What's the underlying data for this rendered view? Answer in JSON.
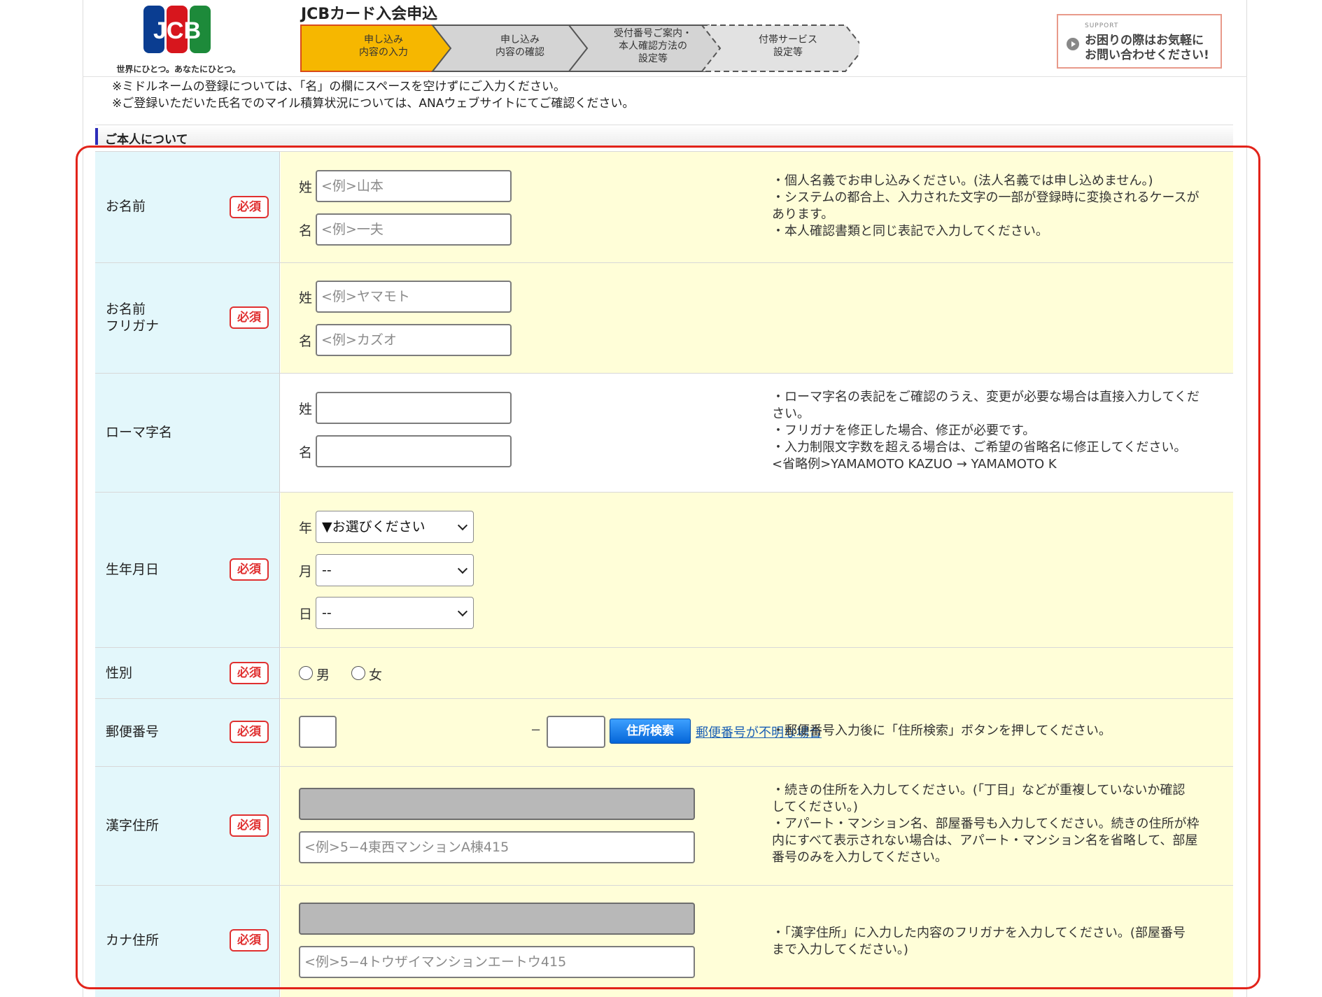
{
  "header": {
    "logo_text": "JCB",
    "logo_tagline": "世界にひとつ。あなたにひとつ。",
    "title": "JCBカード入会申込",
    "steps": [
      {
        "line1": "申し込み",
        "line2": "内容の入力",
        "line3": ""
      },
      {
        "line1": "申し込み",
        "line2": "内容の確認",
        "line3": ""
      },
      {
        "line1": "受付番号ご案内・",
        "line2": "本人確認方法の",
        "line3": "設定等"
      },
      {
        "line1": "付帯サービス",
        "line2": "設定等",
        "line3": ""
      }
    ],
    "support": {
      "small": "SUPPORT",
      "line1": "お困りの際はお気軽に",
      "line2": "お問い合わせください!"
    }
  },
  "notes": [
    "※ミドルネームの登録については、「名」の欄にスペースを空けずにご入力ください。",
    "※ご登録いただいた氏名でのマイル積算状況については、ANAウェブサイトにてご確認ください。"
  ],
  "section": {
    "title": "ご本人について"
  },
  "required_label": "必須",
  "colors": {
    "label_bg": "#e3f7fb",
    "content_bg": "#fffed8",
    "required": "#e03030",
    "accent_button": "#0566d8",
    "highlight_frame": "#e2231a",
    "active_step": "#f6b700"
  },
  "fields": {
    "name": {
      "label": "お名前",
      "sei_label": "姓",
      "sei_placeholder": "<例>山本",
      "mei_label": "名",
      "mei_placeholder": "<例>一夫",
      "help": [
        "・個人名義でお申し込みください。(法人名義では申し込めません。)",
        "・システムの都合上、入力された文字の一部が登録時に変換されるケースが",
        "あります。",
        "・本人確認書類と同じ表記で入力してください。"
      ]
    },
    "furigana": {
      "label1": "お名前",
      "label2": "フリガナ",
      "sei_label": "姓",
      "sei_placeholder": "<例>ヤマモト",
      "mei_label": "名",
      "mei_placeholder": "<例>カズオ"
    },
    "roman": {
      "label": "ローマ字名",
      "sei_label": "姓",
      "sei_value": "",
      "mei_label": "名",
      "mei_value": "",
      "help": [
        "・ローマ字名の表記をご確認のうえ、変更が必要な場合は直接入力してくだ",
        "さい。",
        "・フリガナを修正した場合、修正が必要です。",
        "・入力制限文字数を超える場合は、ご希望の省略名に修正してください。",
        "<省略例>YAMAMOTO KAZUO → YAMAMOTO K"
      ]
    },
    "birthdate": {
      "label": "生年月日",
      "year_label": "年",
      "year_value": "▼お選びください",
      "month_label": "月",
      "month_value": "--",
      "day_label": "日",
      "day_value": "--"
    },
    "gender": {
      "label": "性別",
      "male": "男",
      "female": "女"
    },
    "postal": {
      "label": "郵便番号",
      "separator": "−",
      "search_button": "住所検索",
      "unknown_link": "郵便番号が不明な場合",
      "help": [
        "・郵便番号入力後に「住所検索」ボタンを押してください。"
      ]
    },
    "kanji_address": {
      "label": "漢字住所",
      "line1_value": "",
      "line2_placeholder": "<例>5−4東西マンションA棟415",
      "help": [
        "・続きの住所を入力してください。(「丁目」などが重複していないか確認",
        "してください。)",
        "・アパート・マンション名、部屋番号も入力してください。続きの住所が枠",
        "内にすべて表示されない場合は、アパート・マンション名を省略して、部屋",
        "番号のみを入力してください。"
      ]
    },
    "kana_address": {
      "label": "カナ住所",
      "line1_value": "",
      "line2_placeholder": "<例>5−4トウザイマンションエートウ415",
      "help": [
        "・「漢字住所」に入力した内容のフリガナを入力してください。(部屋番号",
        "まで入力してください。)"
      ]
    }
  }
}
